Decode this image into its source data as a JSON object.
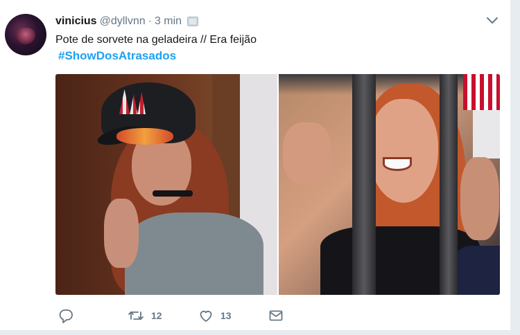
{
  "tweet": {
    "author": {
      "display_name": "vinicius",
      "handle": "@dyllvnn"
    },
    "separator": "·",
    "time": "3 min",
    "text": "Pote de sorvete na geladeira // Era feijão",
    "hashtag": "#ShowDosAtrasados",
    "media": [
      {
        "kind": "photo",
        "subject": "girl in cap making peace sign"
      },
      {
        "kind": "photo",
        "subject": "crying fan behind barrier"
      }
    ],
    "actions": {
      "reply_icon": "reply-icon",
      "retweet_icon": "retweet-icon",
      "retweet_count": "12",
      "like_icon": "heart-icon",
      "like_count": "13",
      "dm_icon": "envelope-icon"
    }
  },
  "colors": {
    "link": "#1da1f2",
    "text": "#14171a",
    "muted": "#657786",
    "background": "#e6ecf0",
    "card": "#ffffff"
  }
}
